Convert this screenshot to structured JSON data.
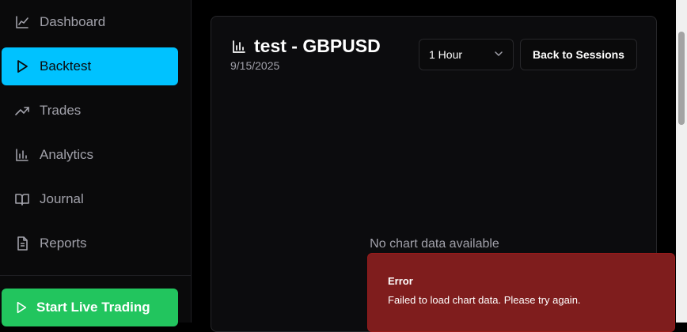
{
  "sidebar": {
    "items": [
      {
        "label": "Dashboard",
        "icon": "line-chart-icon",
        "active": false
      },
      {
        "label": "Backtest",
        "icon": "play-icon",
        "active": true
      },
      {
        "label": "Trades",
        "icon": "trending-up-icon",
        "active": false
      },
      {
        "label": "Analytics",
        "icon": "bar-chart-icon",
        "active": false
      },
      {
        "label": "Journal",
        "icon": "book-open-icon",
        "active": false
      },
      {
        "label": "Reports",
        "icon": "file-text-icon",
        "active": false
      }
    ],
    "live_button": {
      "label": "Start Live Trading",
      "icon": "play-icon"
    }
  },
  "session": {
    "title": "test - GBPUSD",
    "date": "9/15/2025",
    "timeframe": "1 Hour",
    "back_label": "Back to Sessions",
    "empty_message": "No chart data available"
  },
  "toast": {
    "title": "Error",
    "message": "Failed to load chart data. Please try again."
  },
  "colors": {
    "accent": "#00c2ff",
    "live": "#22c55e",
    "error": "#7f1d1d"
  }
}
